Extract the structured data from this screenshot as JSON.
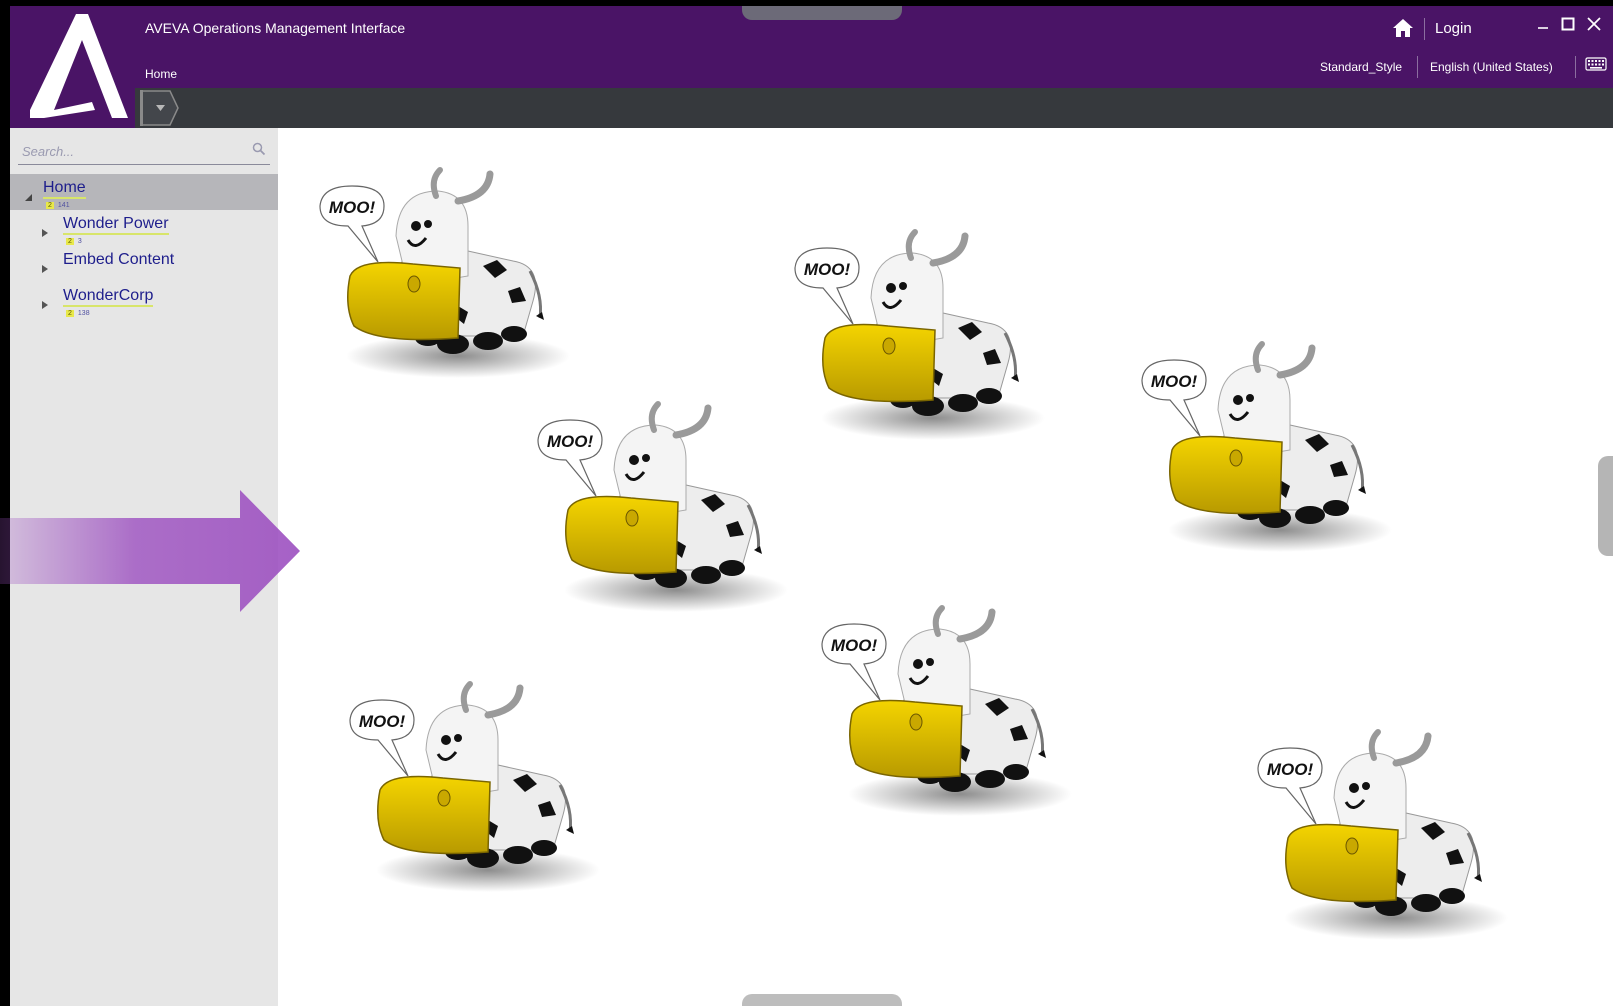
{
  "window": {
    "title": "AVEVA Operations Management Interface",
    "breadcrumb": "Home",
    "login_label": "Login",
    "style_label": "Standard_Style",
    "language_label": "English (United States)",
    "logo_icon": "aveva-logo",
    "brand_color": "#4a1466"
  },
  "sidebar": {
    "search_placeholder": "Search...",
    "tree": [
      {
        "label": "Home",
        "badge_num": "2",
        "badge_count": "141",
        "expanded": true,
        "selected": true
      },
      {
        "label": "Wonder Power",
        "badge_num": "2",
        "badge_count": "3",
        "expanded": false
      },
      {
        "label": "Embed Content",
        "badge_num": "",
        "badge_count": "",
        "expanded": false
      },
      {
        "label": "WonderCorp",
        "badge_num": "2",
        "badge_count": "138",
        "expanded": false
      }
    ]
  },
  "content": {
    "cow_speech": "MOO!",
    "cow_count": 7
  }
}
